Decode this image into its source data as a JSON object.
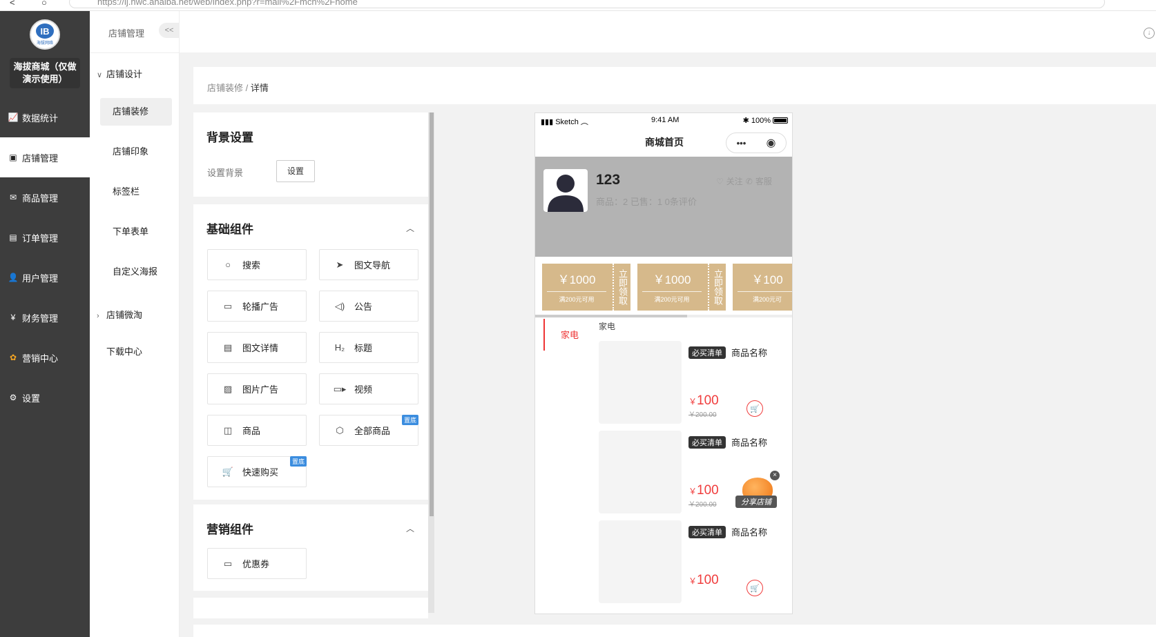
{
  "browser": {
    "url": "https://lj.hwc.anaiba.net/web/index.php?r=mall%2Fmch%2Fhome",
    "back_glyph": "<",
    "reload_glyph": "○"
  },
  "sidebar": {
    "logo_mark": "IB",
    "logo_sub": "海拔网络",
    "shop_name": "海拔商城（仅做演示使用）",
    "items": [
      {
        "label": "数据统计",
        "icon": "chart-icon",
        "glyph": "📈"
      },
      {
        "label": "店铺管理",
        "icon": "store-icon",
        "glyph": "▣"
      },
      {
        "label": "商品管理",
        "icon": "goods-icon",
        "glyph": "✉"
      },
      {
        "label": "订单管理",
        "icon": "order-icon",
        "glyph": "▤"
      },
      {
        "label": "用户管理",
        "icon": "user-icon",
        "glyph": "👤"
      },
      {
        "label": "财务管理",
        "icon": "finance-icon",
        "glyph": "¥"
      },
      {
        "label": "营销中心",
        "icon": "marketing-icon",
        "glyph": "✿"
      },
      {
        "label": "设置",
        "icon": "settings-icon",
        "glyph": "⚙"
      }
    ]
  },
  "submenu": {
    "title": "店铺管理",
    "collapse": "<<",
    "group1": "店铺设计",
    "items": [
      "店铺装修",
      "店铺印象",
      "标签栏",
      "下单表单",
      "自定义海报"
    ],
    "group2": "店铺微淘",
    "download": "下载中心"
  },
  "breadcrumb": {
    "parent": "店铺装修",
    "sep": "/",
    "current": "详情"
  },
  "bg_settings": {
    "title": "背景设置",
    "label": "设置背景",
    "button": "设置"
  },
  "basic": {
    "title": "基础组件",
    "items": [
      {
        "label": "搜索",
        "glyph": "○"
      },
      {
        "label": "图文导航",
        "glyph": "➤"
      },
      {
        "label": "轮播广告",
        "glyph": "▭"
      },
      {
        "label": "公告",
        "glyph": "◁)"
      },
      {
        "label": "图文详情",
        "glyph": "▤"
      },
      {
        "label": "标题",
        "glyph": "H₂"
      },
      {
        "label": "图片广告",
        "glyph": "▨"
      },
      {
        "label": "视频",
        "glyph": "▭▸"
      },
      {
        "label": "商品",
        "glyph": "◫"
      },
      {
        "label": "全部商品",
        "glyph": "⬡",
        "badge": "置底"
      },
      {
        "label": "快速购买",
        "glyph": "🛒",
        "badge": "置底"
      }
    ]
  },
  "marketing": {
    "title": "营销组件",
    "items": [
      {
        "label": "优惠券",
        "glyph": "▭"
      }
    ]
  },
  "phone": {
    "carrier": "Sketch",
    "time": "9:41 AM",
    "battery": "100%",
    "title": "商城首页",
    "capsule_more": "•••",
    "capsule_target": "◉",
    "shop_title": "123",
    "stats": "商品：2    已售：1    0条评价",
    "follow": "关注",
    "service": "客服",
    "coupons": [
      {
        "amount": "￥1000",
        "cond": "满200元可用",
        "get": "立即领取"
      },
      {
        "amount": "￥1000",
        "cond": "满200元可用",
        "get": "立即领取"
      },
      {
        "amount": "￥100",
        "cond": "满200元可",
        "get": ""
      }
    ],
    "category_active": "家电",
    "category_head": "家电",
    "goods": [
      {
        "tag": "必买清单",
        "name": "商品名称",
        "currency": "￥",
        "price": "100",
        "orig": "￥200.00"
      },
      {
        "tag": "必买清单",
        "name": "商品名称",
        "currency": "￥",
        "price": "100",
        "orig": "￥200.00"
      },
      {
        "tag": "必买清单",
        "name": "商品名称",
        "currency": "￥",
        "price": "100",
        "orig": ""
      }
    ],
    "share_label": "分享店铺",
    "share_close": "×"
  }
}
